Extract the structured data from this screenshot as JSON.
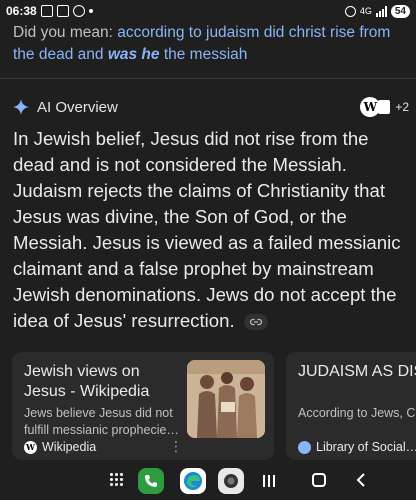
{
  "status": {
    "time": "06:38",
    "network": "4G",
    "battery": "54"
  },
  "suggestion": {
    "prefix": "Did you mean: ",
    "link_part1": "according to judaism did christ rise from the dead and ",
    "link_bold": "was he",
    "link_part2": " the messiah"
  },
  "ai_overview": {
    "title": "AI Overview",
    "source_icon": "W",
    "more_sources": "+2",
    "body": "In Jewish belief, Jesus did not rise from the dead and is not considered the Messiah. Judaism rejects the claims of Christianity that Jesus was divine, the Son of God, or the Messiah. Jesus is viewed as a failed messianic claimant and a false prophet by mainstream Jewish denominations. Jews do not accept the idea of Jesus' resurrection."
  },
  "cards": [
    {
      "title": "Jewish views on Jesus - Wikipedia",
      "snippet": "Jews believe Jesus did not fulfill messianic prophecie…",
      "source": "Wikipedia",
      "source_logo": "W",
      "more": "⋮"
    },
    {
      "title": "JUDAISM AS DISBELIEF IN THE",
      "snippet": "According to Jews, Ch… was not God—was no…",
      "source": "Library of Social…"
    }
  ],
  "colors": {
    "background": "#1f1f1f",
    "link": "#8ab4f8",
    "card": "#2b2b2b"
  }
}
